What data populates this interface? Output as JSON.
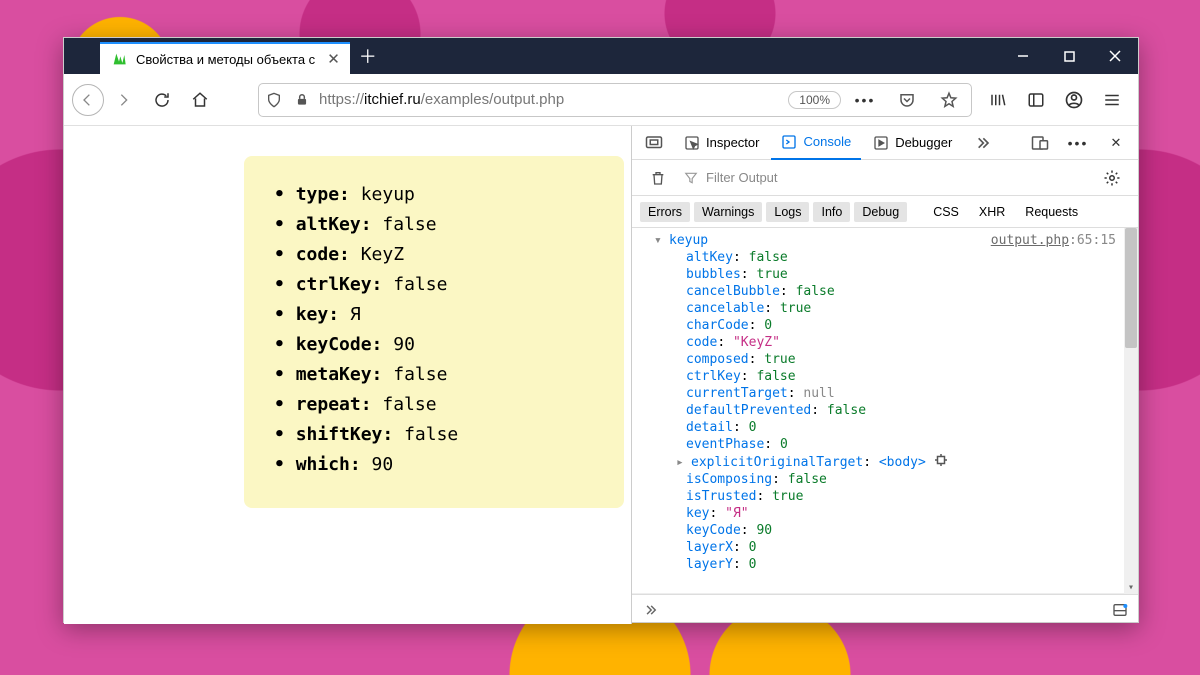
{
  "window": {
    "tabTitle": "Свойства и методы объекта с"
  },
  "nav": {
    "urlPrefix": "https://",
    "urlDomain": "itchief.ru",
    "urlPath": "/examples/output.php",
    "zoom": "100%"
  },
  "page": {
    "items": [
      {
        "k": "type",
        "v": "keyup"
      },
      {
        "k": "altKey",
        "v": "false"
      },
      {
        "k": "code",
        "v": "KeyZ"
      },
      {
        "k": "ctrlKey",
        "v": "false"
      },
      {
        "k": "key",
        "v": "Я"
      },
      {
        "k": "keyCode",
        "v": "90"
      },
      {
        "k": "metaKey",
        "v": "false"
      },
      {
        "k": "repeat",
        "v": "false"
      },
      {
        "k": "shiftKey",
        "v": "false"
      },
      {
        "k": "which",
        "v": "90"
      }
    ]
  },
  "devtools": {
    "tabs": {
      "inspector": "Inspector",
      "console": "Console",
      "debugger": "Debugger"
    },
    "filterPlaceholder": "Filter Output",
    "filters": {
      "errors": "Errors",
      "warnings": "Warnings",
      "logs": "Logs",
      "info": "Info",
      "debug": "Debug",
      "css": "CSS",
      "xhr": "XHR",
      "requests": "Requests"
    },
    "sourceFile": "output.php",
    "sourceLoc": "65:15",
    "eventName": "keyup",
    "props": [
      {
        "k": "altKey",
        "v": "false",
        "t": "bool"
      },
      {
        "k": "bubbles",
        "v": "true",
        "t": "bool"
      },
      {
        "k": "cancelBubble",
        "v": "false",
        "t": "bool"
      },
      {
        "k": "cancelable",
        "v": "true",
        "t": "bool"
      },
      {
        "k": "charCode",
        "v": "0",
        "t": "num"
      },
      {
        "k": "code",
        "v": "\"KeyZ\"",
        "t": "str"
      },
      {
        "k": "composed",
        "v": "true",
        "t": "bool"
      },
      {
        "k": "ctrlKey",
        "v": "false",
        "t": "bool"
      },
      {
        "k": "currentTarget",
        "v": "null",
        "t": "null"
      },
      {
        "k": "defaultPrevented",
        "v": "false",
        "t": "bool"
      },
      {
        "k": "detail",
        "v": "0",
        "t": "num"
      },
      {
        "k": "eventPhase",
        "v": "0",
        "t": "num"
      },
      {
        "k": "explicitOriginalTarget",
        "v": "<body>",
        "t": "node",
        "expandable": true
      },
      {
        "k": "isComposing",
        "v": "false",
        "t": "bool"
      },
      {
        "k": "isTrusted",
        "v": "true",
        "t": "bool"
      },
      {
        "k": "key",
        "v": "\"Я\"",
        "t": "str"
      },
      {
        "k": "keyCode",
        "v": "90",
        "t": "num"
      },
      {
        "k": "layerX",
        "v": "0",
        "t": "num"
      },
      {
        "k": "layerY",
        "v": "0",
        "t": "num"
      }
    ]
  }
}
